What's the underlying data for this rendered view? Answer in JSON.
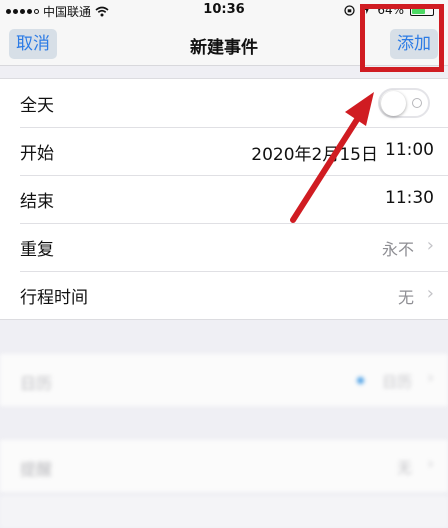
{
  "status_bar": {
    "carrier": "中国联通",
    "time": "10:36",
    "battery": "64%",
    "battery_level": 0.64
  },
  "nav": {
    "cancel_label": "取消",
    "title": "新建事件",
    "add_label": "添加"
  },
  "form": {
    "all_day_label": "全天",
    "all_day_on": false,
    "start_label": "开始",
    "start_date": "2020年2月15日",
    "start_time": "11:00",
    "end_label": "结束",
    "end_time": "11:30",
    "repeat_label": "重复",
    "repeat_value": "永不",
    "travel_label": "行程时间",
    "travel_value": "无"
  },
  "blurred": {
    "calendar_label": "日历",
    "calendar_value": "日历",
    "alert_label": "提醒",
    "alert_value": "无"
  },
  "annotation": {
    "color": "#d01c22"
  },
  "colors": {
    "accent": "#2c7be5",
    "toggle_off_border": "#e4e4e8"
  }
}
